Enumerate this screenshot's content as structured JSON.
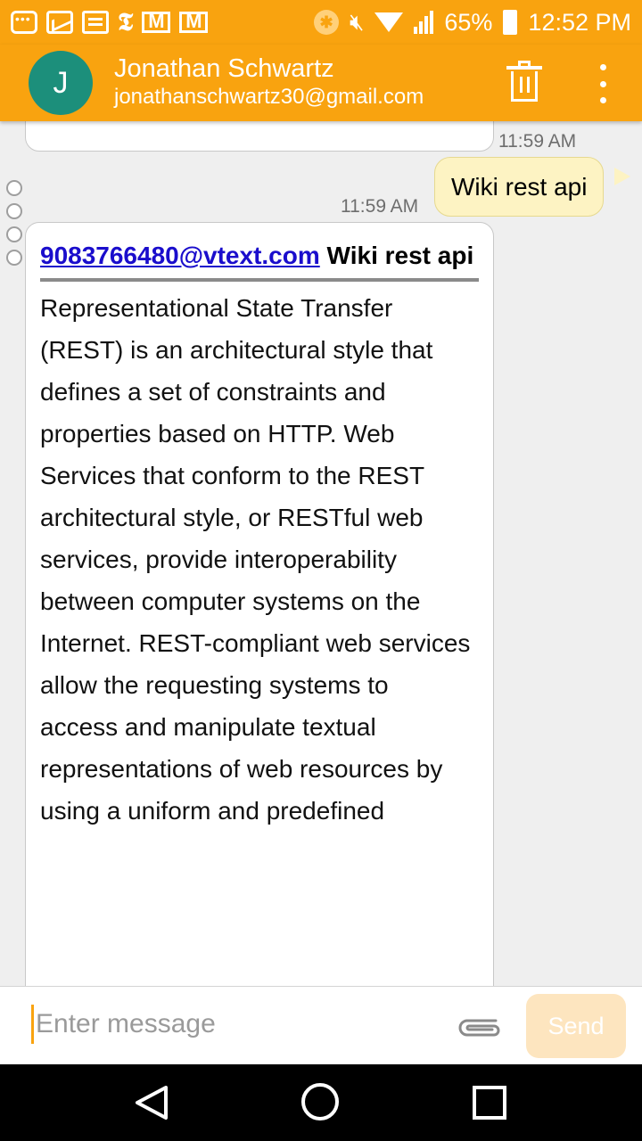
{
  "status_bar": {
    "battery": "65%",
    "time": "12:52 PM"
  },
  "header": {
    "avatar_letter": "J",
    "contact_name": "Jonathan Schwartz",
    "contact_email": "jonathanschwartz30@gmail.com"
  },
  "conversation": {
    "prev_timestamp": "11:59 AM",
    "sent": {
      "text": "Wiki rest api",
      "timestamp": "11:59 AM"
    },
    "received": {
      "link": "9083766480@vtext.com",
      "subject": " Wiki rest api",
      "body_lines": [
        "Representational State Transfer (REST) is an architectural style that",
        "defines a set of constraints and properties based on HTTP. Web Services that conform to the REST architectural style, or RESTful web services, provide interoperability between computer systems on the Internet. REST-compliant web services allow the requesting systems to",
        "access and manipulate textual representations of web resources by",
        "using a uniform and predefined"
      ]
    }
  },
  "composer": {
    "placeholder": "Enter message",
    "send_label": "Send"
  },
  "colors": {
    "accent": "#f9a30f",
    "avatar": "#1c8f7b",
    "sent_bubble": "#fdf3c3",
    "link": "#1a0dcc"
  },
  "icons": [
    "trash-icon",
    "overflow-menu-icon",
    "attach-icon",
    "nav-back-icon",
    "nav-home-icon",
    "nav-recents-icon"
  ]
}
